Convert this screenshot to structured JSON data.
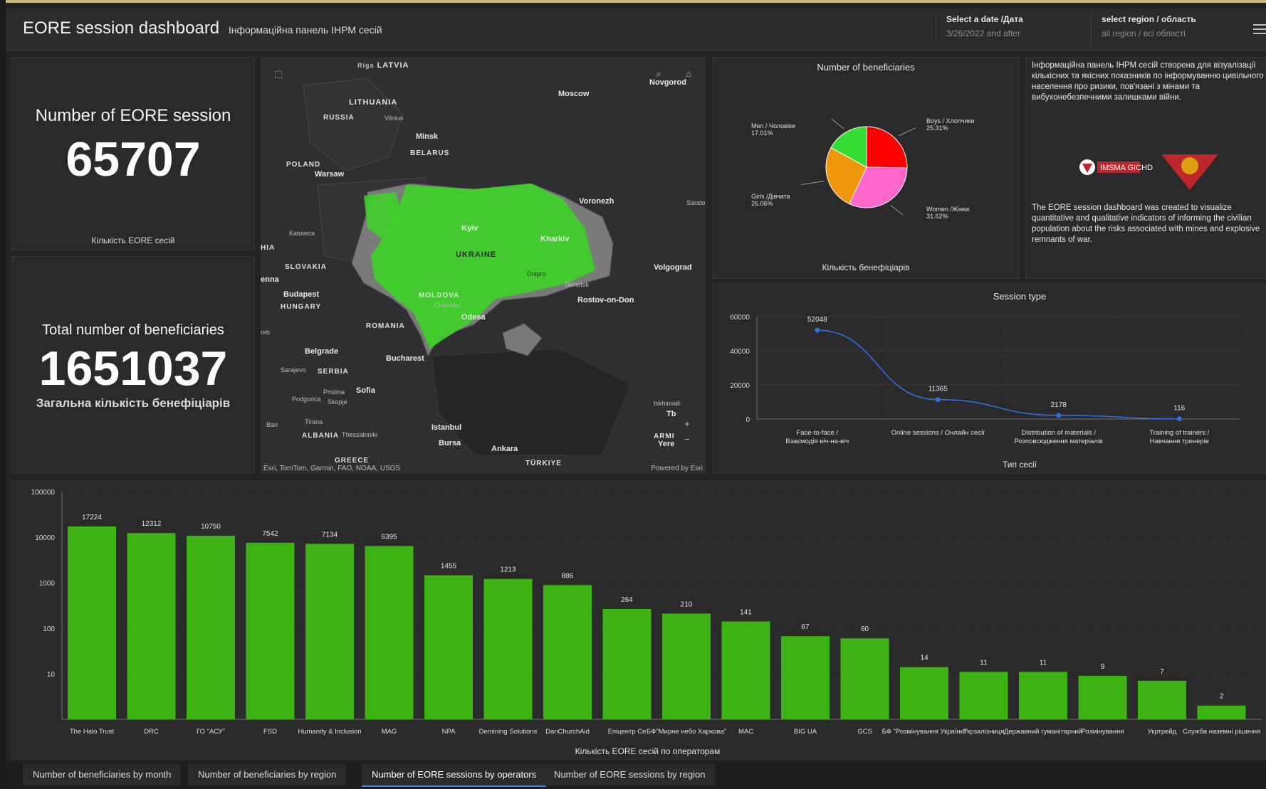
{
  "header": {
    "title": "EORE session dashboard",
    "subtitle": "Інформаційна панель ІНРМ сесій",
    "date_selector": {
      "label": "Select a date /Дата",
      "value": "3/26/2022 and after"
    },
    "region_selector": {
      "label": "select region / область",
      "value": "all region / всі області"
    }
  },
  "kpi_sessions": {
    "title": "Number of EORE session",
    "value": "65707",
    "subtitle": "Кількість EORE сесій"
  },
  "kpi_beneficiaries": {
    "title": "Total number of beneficiaries",
    "value": "1651037",
    "subtitle": "Загальна кількість бенефіціарів"
  },
  "map": {
    "labels": {
      "latvia": "LATVIA",
      "riga": "Riga",
      "lithuania": "LITHUANIA",
      "russia": "RUSSIA",
      "vilnius": "Vilnius",
      "moscow": "Moscow",
      "novgorod": "Novgorod",
      "minsk": "Minsk",
      "belarus": "BELARUS",
      "poland": "POLAND",
      "warsaw": "Warsaw",
      "voronezh": "Voronezh",
      "saratov": "Sarato",
      "katowice": "Katowice",
      "kyiv": "Kyiv",
      "kharkiv": "Kharkiv",
      "ukraine": "UKRAINE",
      "slovakia": "SLOVAKIA",
      "hia": "HIA",
      "vienna": "enna",
      "volgograd": "Volgograd",
      "dnipro": "Dnipro",
      "donetsk": "Donetsk",
      "budapest": "Budapest",
      "hungary": "HUNGARY",
      "moldova": "MOLDOVA",
      "chisinau": "Chișinău",
      "rostov": "Rostov-on-Don",
      "odesa": "Odesa",
      "romania": "ROMANIA",
      "zagreb": "reb",
      "belgrade": "Belgrade",
      "bucharest": "Bucharest",
      "sarajevo": "Sarajevo",
      "serbia": "SERBIA",
      "pristina": "Pristina",
      "podgorica": "Podgorica",
      "sofia": "Sofia",
      "skopje": "Skopje",
      "tirana": "Tirana",
      "bari": "Bari",
      "albania": "ALBANIA",
      "thessaloniki": "Thessaloniki",
      "istanbul": "Istanbul",
      "bursa": "Bursa",
      "greece": "GREECE",
      "ankara": "Ankara",
      "turkiye": "TÜRKIYE",
      "tskhinvali": "tskhinvali",
      "tbilisi": "Tb",
      "armenia": "ARMI",
      "yerevan": "Yere"
    },
    "attribution": "Esri, TomTom, Garmin, FAO, NOAA, USGS",
    "powered_by": "Powered by Esri"
  },
  "pie": {
    "title": "Number of beneficiaries",
    "subtitle": "Кількість бенефіціарів",
    "labels": {
      "men": "Men / Чоловіки",
      "men_pct": "17.01%",
      "boys": "Boys / Хлопчики",
      "boys_pct": "25.31%",
      "girls": "Girls /Дівчата",
      "girls_pct": "26.06%",
      "women": "Women /Жінки",
      "women_pct": "31.62%"
    }
  },
  "info": {
    "ua_text": "Інформаційна панель ІНРМ сесій створена для візуалізації кількісних та якісних показників по інформуванню цивільного населення про ризики, пов'язані з мінами та вибухонебезпечними залишками війни.",
    "en_text": "The EORE session dashboard was created to visualize quantitative and qualitative indicators of informing the civilian population about the risks associated with mines and explosive remnants of war.",
    "logo_text": "IMSMA GICHD"
  },
  "line": {
    "title": "Session type",
    "subtitle": "Тип сесії"
  },
  "bar": {
    "title": "Кількість EORE сесій по операторам"
  },
  "chart_data": [
    {
      "type": "pie",
      "title": "Number of beneficiaries",
      "categories": [
        "Boys / Хлопчики",
        "Women /Жінки",
        "Girls /Дівчата",
        "Men / Чоловіки"
      ],
      "values": [
        25.31,
        31.62,
        26.06,
        17.01
      ],
      "colors": [
        "#ff0000",
        "#ff66cc",
        "#f0960a",
        "#33dd33"
      ]
    },
    {
      "type": "line",
      "title": "Session type",
      "xlabel": "Тип сесії",
      "categories": [
        "Face-to-face / Взаємодія віч-на-віч",
        "Online sessions / Онлайн сесії",
        "Distribution of materials / Розповсюдження матеріалів",
        "Training of trainers / Навчання тренерів"
      ],
      "values": [
        52048,
        11365,
        2178,
        116
      ],
      "ylim": [
        0,
        60000
      ],
      "yticks": [
        0,
        20000,
        40000,
        60000
      ],
      "color": "#2f6fe0"
    },
    {
      "type": "bar",
      "xlabel": "Кількість EORE сесій по операторам",
      "scale": "log",
      "ylim": [
        1,
        100000
      ],
      "yticks": [
        10,
        100,
        1000,
        10000,
        100000
      ],
      "categories": [
        "The Halo Trust",
        "DRC",
        "ГО \"АСУ\"",
        "FSD",
        "Humanity & Inclusion",
        "MAG",
        "NPA",
        "Demining Solutions",
        "DanChurchAid",
        "Епіцентр Се",
        "БФ\"Мирне небо Харкова\"",
        "MAC",
        "BIG UA",
        "GCS",
        "БФ \"Розмінування України\"",
        "Укрзалізниця",
        "Державний гуманітарний",
        "Розмінування",
        "Укртрейд",
        "Служба наземні рішення"
      ],
      "labels": [
        "The Halo Trust",
        "DRC",
        "ГО \"АСУ\"",
        "FSD",
        "Humanity & Inclusion",
        "MAG",
        "NPA",
        "Demining Solutions",
        "DanChurchAid",
        "Епіцентр Се",
        "БФ\"Мирне небо Харкова\"",
        "MAC",
        "BIG UA",
        "GCS",
        "БФ \"Розмінування України\"",
        "Укрзалізниця",
        "Державний гуманітарний",
        "Розмінування",
        "Укртрейд",
        "Служба наземні рішення"
      ],
      "values": [
        17224,
        12312,
        10750,
        7542,
        7134,
        6395,
        1455,
        1213,
        886,
        264,
        210,
        141,
        67,
        60,
        14,
        11,
        11,
        9,
        7,
        2
      ],
      "color": "#3cb312"
    }
  ],
  "tabs": [
    {
      "label": "Number of beneficiaries by month"
    },
    {
      "label": "Number of beneficiaries by region"
    },
    {
      "label": "Number of EORE sessions by operators"
    },
    {
      "label": "Number of EORE sessions by region"
    }
  ]
}
